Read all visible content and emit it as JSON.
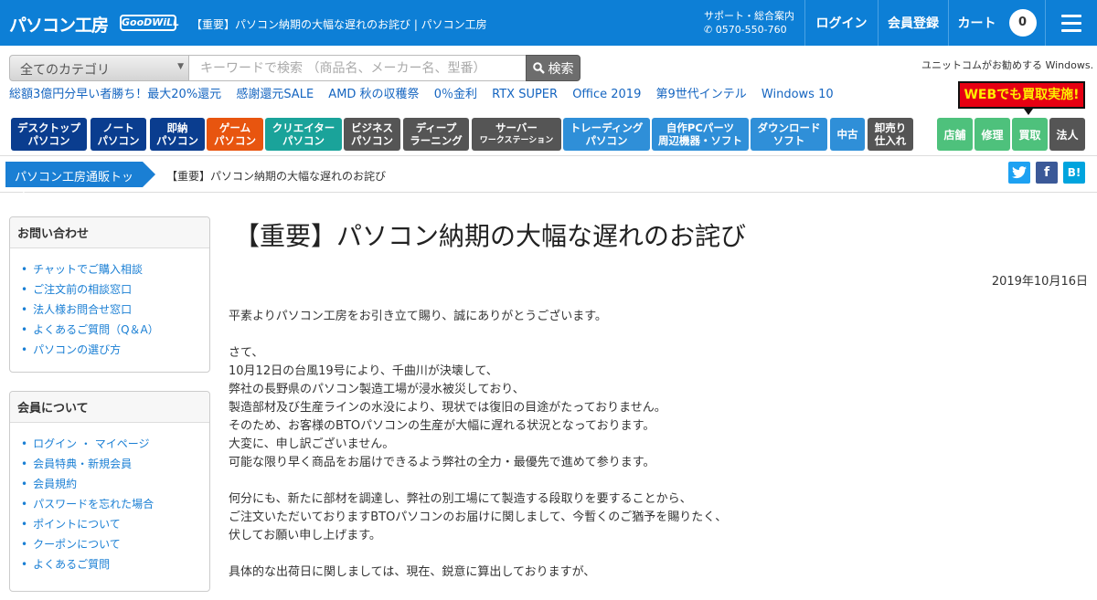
{
  "header": {
    "logo": "パソコン工房",
    "goodwill": "GooDWiLL",
    "page_title": "【重要】パソコン納期の大幅な遅れのお詫び | パソコン工房",
    "support_label": "サポート・総合案内",
    "support_phone": "0570-550-760",
    "login": "ログイン",
    "register": "会員登録",
    "cart": "カート",
    "cart_count": "0"
  },
  "search": {
    "category": "全てのカテゴリ",
    "placeholder": "キーワードで検索 （商品名、メーカー名、型番）",
    "button": "検索",
    "windows_text": "ユニットコムがお勧めする Windows."
  },
  "promo_links": [
    "総額3億円分早い者勝ち！最大20%還元",
    "感謝還元SALE",
    "AMD 秋の収穫祭",
    "0％金利",
    "RTX SUPER",
    "Office 2019",
    "第9世代インテル",
    "Windows 10"
  ],
  "kaitori_banner": "WEBでも買取実施!",
  "category_nav": [
    {
      "l1": "デスクトップ",
      "l2": "パソコン",
      "color": "#0a3d8f"
    },
    {
      "l1": "ノート",
      "l2": "パソコン",
      "color": "#0a3d8f"
    },
    {
      "l1": "即納",
      "l2": "パソコン",
      "color": "#0a3d8f"
    },
    {
      "l1": "ゲーム",
      "l2": "パソコン",
      "color": "#e8550f"
    },
    {
      "l1": "クリエイター",
      "l2": "パソコン",
      "color": "#1aa39a"
    },
    {
      "l1": "ビジネス",
      "l2": "パソコン",
      "color": "#555555"
    },
    {
      "l1": "ディープ",
      "l2": "ラーニング",
      "color": "#555555"
    },
    {
      "l1": "サーバー",
      "l2": "ワークステーション",
      "color": "#555555"
    },
    {
      "l1": "トレーディング",
      "l2": "パソコン",
      "color": "#2f8fd8"
    },
    {
      "l1": "自作PCパーツ",
      "l2": "周辺機器・ソフト",
      "color": "#2f8fd8"
    },
    {
      "l1": "ダウンロード",
      "l2": "ソフト",
      "color": "#2f8fd8"
    },
    {
      "l1": "中古",
      "l2": "",
      "color": "#2f8fd8"
    },
    {
      "l1": "卸売り",
      "l2": "仕入れ",
      "color": "#555555"
    }
  ],
  "service_nav": [
    "店舗",
    "修理",
    "買取",
    "法人"
  ],
  "breadcrumb": {
    "home": "パソコン工房通販トップ",
    "current": "【重要】パソコン納期の大幅な遅れのお詫び"
  },
  "sidebar": {
    "contact_title": "お問い合わせ",
    "contact_items": [
      "チャットでご購入相談",
      "ご注文前の相談窓口",
      "法人様お問合せ窓口",
      "よくあるご質問（Q＆A）",
      "パソコンの選び方"
    ],
    "member_title": "会員について",
    "member_items": [
      "ログイン ・ マイページ",
      "会員特典・新規会員",
      "会員規約",
      "パスワードを忘れた場合",
      "ポイントについて",
      "クーポンについて",
      "よくあるご質問"
    ]
  },
  "article": {
    "title": "【重要】パソコン納期の大幅な遅れのお詫び",
    "date": "2019年10月16日",
    "p1": [
      "平素よりパソコン工房をお引き立て賜り、誠にありがとうございます。"
    ],
    "p2": [
      "さて、",
      "10月12日の台風19号により、千曲川が決壊して、",
      "弊社の長野県のパソコン製造工場が浸水被災しており、",
      "製造部材及び生産ラインの水没により、現状では復旧の目途がたっておりません。",
      "そのため、お客様のBTOパソコンの生産が大幅に遅れる状況となっております。",
      "大変に、申し訳ございません。",
      "可能な限り早く商品をお届けできるよう弊社の全力・最優先で進めて参ります。"
    ],
    "p3": [
      "何分にも、新たに部材を調達し、弊社の別工場にて製造する段取りを要することから、",
      "ご注文いただいておりますBTOパソコンのお届けに関しまして、今暫くのご猶予を賜りたく、",
      "伏してお願い申し上げます。"
    ],
    "p4": [
      "具体的な出荷日に関しましては、現在、鋭意に算出しておりますが、"
    ]
  }
}
